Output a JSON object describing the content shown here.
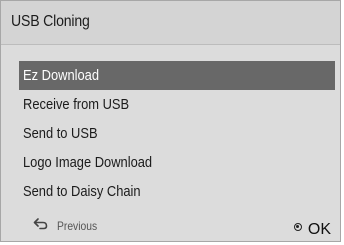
{
  "window": {
    "title": "USB Cloning"
  },
  "menu": {
    "items": [
      {
        "label": "Ez Download",
        "selected": true
      },
      {
        "label": "Receive from USB",
        "selected": false
      },
      {
        "label": "Send to USB",
        "selected": false
      },
      {
        "label": "Logo Image Download",
        "selected": false
      },
      {
        "label": "Send to Daisy Chain",
        "selected": false
      }
    ]
  },
  "footer": {
    "previous_label": "Previous",
    "previous_icon": "return-arrow-icon",
    "ok_label": "OK",
    "ok_icon": "ok-button-icon"
  },
  "colors": {
    "selected_background": "#686868",
    "selected_text": "#ffffff",
    "panel_background": "#dcdcdc"
  }
}
